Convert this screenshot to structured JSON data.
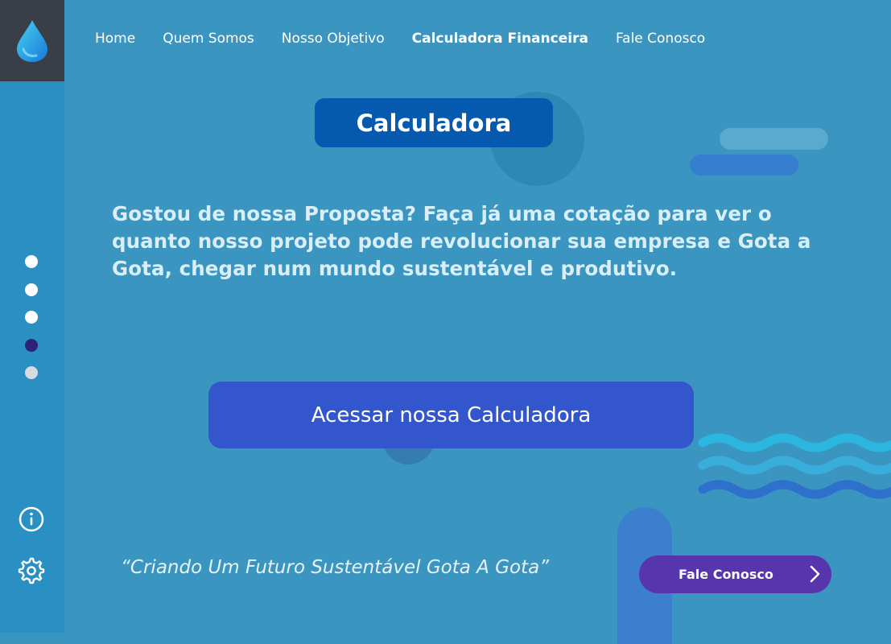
{
  "nav": {
    "items": [
      {
        "label": "Home"
      },
      {
        "label": "Quem Somos"
      },
      {
        "label": "Nosso Objetivo"
      },
      {
        "label": "Calculadora Financeira"
      },
      {
        "label": "Fale Conosco"
      }
    ],
    "current_index": 3
  },
  "sidebar": {
    "pager": {
      "count": 5,
      "active_index": 3
    },
    "info_icon": "info-icon",
    "settings_icon": "gear-icon"
  },
  "hero": {
    "title": "Calculadora",
    "lead": "Gostou de nossa Proposta? Faça já uma cotação para ver o quanto nosso projeto pode revolucionar sua empresa e Gota a Gota,  chegar num mundo sustentável e produtivo.",
    "cta_label": "Acessar nossa Calculadora"
  },
  "footer": {
    "quote": "“Criando Um Futuro Sustentável Gota A Gota”",
    "contact_button_label": "Fale Conosco"
  },
  "colors": {
    "background": "#3a96c0",
    "sidebar": "#2a90c4",
    "logo_box": "#3a3e47",
    "title_pill": "#055ab0",
    "cta": "#3356cc",
    "contact_button": "#5635ad",
    "active_dot": "#2b2479"
  }
}
